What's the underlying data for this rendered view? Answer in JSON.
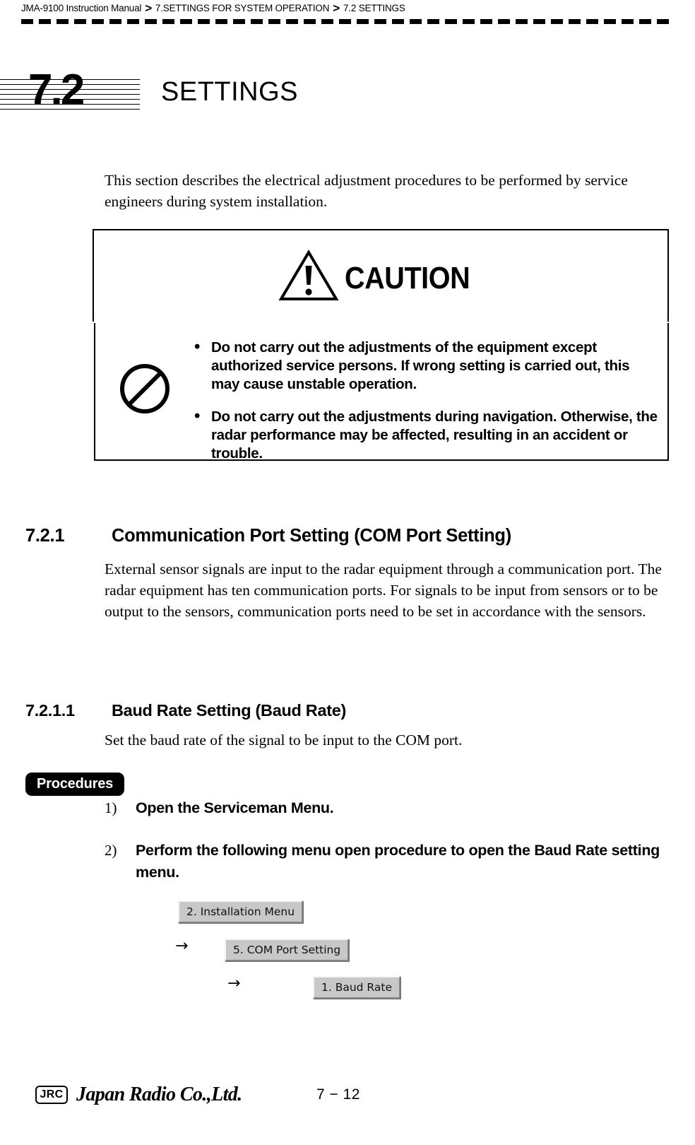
{
  "header": {
    "breadcrumb": [
      "JMA-9100 Instruction Manual",
      "7.SETTINGS FOR SYSTEM OPERATION",
      "7.2  SETTINGS"
    ],
    "separator": ">"
  },
  "chapter": {
    "number": "7.2",
    "title": "SETTINGS"
  },
  "intro": {
    "paragraph": "This section describes the electrical adjustment procedures to be performed by service engineers during system installation."
  },
  "caution": {
    "heading": "CAUTION",
    "warning_icon": "warning-triangle-exclamation-icon",
    "prohibition_icon": "prohibition-circle-icon",
    "bullet": "•",
    "items": [
      "Do not carry out the adjustments of the equipment except authorized service persons. If wrong setting is carried out, this may cause unstable operation.",
      "Do not carry out the adjustments during navigation. Otherwise, the radar performance may be affected, resulting in an accident or trouble."
    ]
  },
  "section_721": {
    "number": "7.2.1",
    "title": "Communication Port Setting (COM Port Setting)",
    "paragraph": "External sensor signals are input to the radar equipment through a communication port. The radar equipment has ten communication ports. For signals to be input from sensors or to be output to the sensors, communication ports need to be set in accordance with the sensors."
  },
  "section_7211": {
    "number": "7.2.1.1",
    "title": "Baud Rate Setting (Baud Rate)",
    "paragraph": "Set the baud rate of the signal to be input to the COM port."
  },
  "procedures": {
    "badge": "Procedures",
    "steps": [
      {
        "number": "1)",
        "text": "Open the Serviceman Menu."
      },
      {
        "number": "2)",
        "text": "Perform the following menu open procedure to open the Baud Rate setting menu."
      }
    ],
    "menu_path": {
      "arrow": "→",
      "buttons": [
        "2. Installation Menu",
        "5. COM Port Setting",
        "1. Baud Rate"
      ]
    }
  },
  "footer": {
    "logo_mark": "JRC",
    "company": "Japan Radio Co.,Ltd.",
    "page_number": "7 − 12"
  },
  "colors": {
    "text": "#000000",
    "page_background": "#ffffff",
    "menu_button_face": "#c8c8c8",
    "menu_button_highlight": "#f4f4f4",
    "menu_button_shadow": "#848484",
    "badge_background": "#000000",
    "badge_text": "#ffffff"
  }
}
